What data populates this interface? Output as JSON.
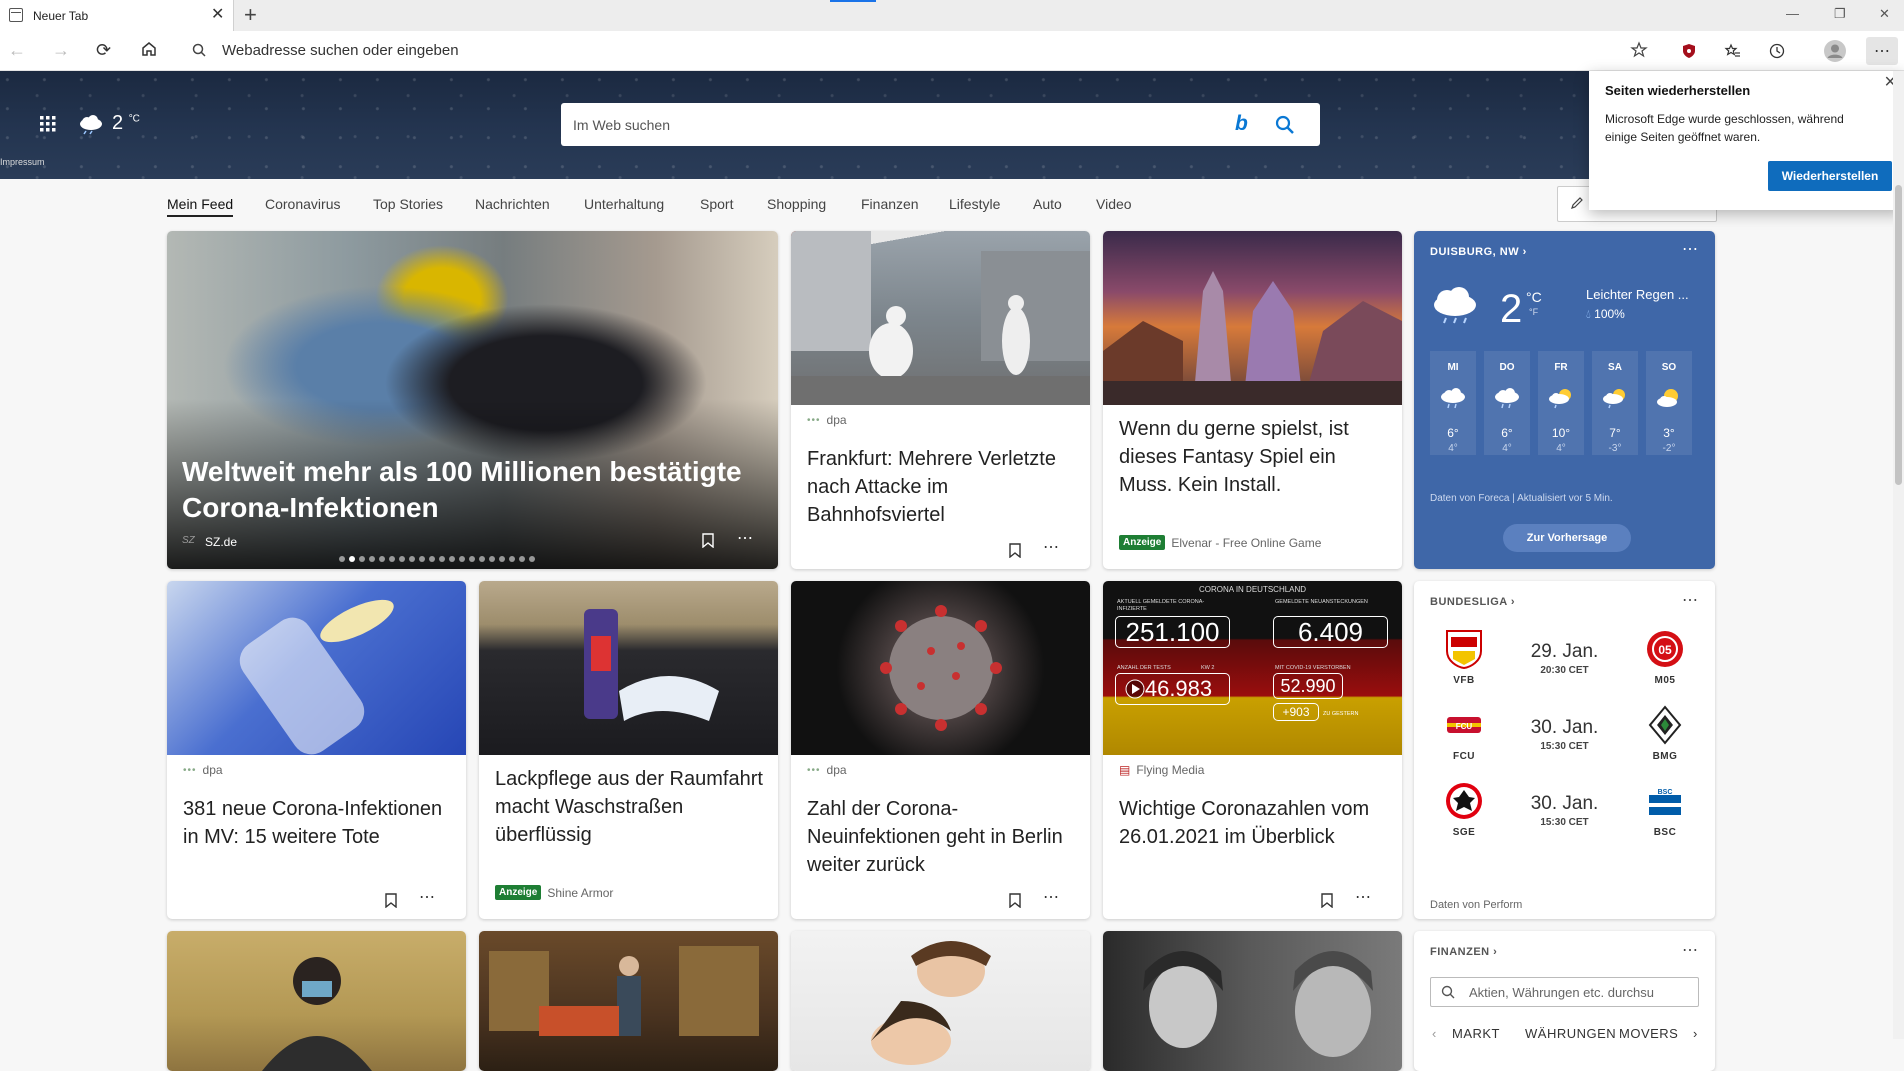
{
  "tab": {
    "title": "Neuer Tab"
  },
  "toolbar": {
    "address_placeholder": "Webadresse suchen oder eingeben"
  },
  "hero": {
    "temp": "2",
    "unit": "°C",
    "impressum": "Impressum",
    "search_placeholder": "Im Web suchen"
  },
  "feed_tabs": [
    "Mein Feed",
    "Coronavirus",
    "Top Stories",
    "Nachrichten",
    "Unterhaltung",
    "Sport",
    "Shopping",
    "Finanzen",
    "Lifestyle",
    "Auto",
    "Video"
  ],
  "restore_popup": {
    "title": "Seiten wiederherstellen",
    "body": "Microsoft Edge wurde geschlossen, während einige Seiten geöffnet waren.",
    "button": "Wiederherstellen"
  },
  "hero_card": {
    "title": "Weltweit mehr als 100 Millionen bestätigte Corona-Infektionen",
    "source": "SZ.de",
    "source_logo": "SZ",
    "slide_count": 20,
    "active_slide": 2
  },
  "cards": {
    "c1": {
      "source": "dpa",
      "title": "Frankfurt: Mehrere Verletzte nach Attacke im Bahnhofsviertel"
    },
    "c2": {
      "ad_label": "Anzeige",
      "source": "Elvenar - Free Online Game",
      "title": "Wenn du gerne spielst, ist dieses Fantasy Spiel ein Muss. Kein Install."
    },
    "c3": {
      "source": "dpa",
      "title": "381 neue Corona-Infektionen in MV: 15 weitere Tote"
    },
    "c4": {
      "ad_label": "Anzeige",
      "source": "Shine Armor",
      "title": "Lackpflege aus der Raumfahrt macht Waschstraßen überflüssig"
    },
    "c5": {
      "source": "dpa",
      "title": "Zahl der Corona-Neuinfektionen geht in Berlin weiter zurück"
    },
    "c6": {
      "source": "Flying Media",
      "title": "Wichtige Coronazahlen vom 26.01.2021 im Überblick",
      "graphic": {
        "header": "CORONA IN DEUTSCHLAND",
        "l1": "AKTUELL GEMELDETE CORONA-INFIZIERTE",
        "v1": "251.100",
        "l2": "GEMELDETE NEUANSTECKUNGEN",
        "v2": "6.409",
        "l3": "ANZAHL DER TESTS",
        "l3b": "KW 2",
        "v3": "46.983",
        "l4": "MIT COVID-19 VERSTORBEN",
        "v4": "52.990",
        "v5": "+903",
        "l5": "ZU GESTERN"
      }
    }
  },
  "weather": {
    "location": "DUISBURG, NW",
    "temp": "2",
    "unit_c": "°C",
    "unit_f": "°F",
    "condition": "Leichter Regen ...",
    "precip": "100%",
    "forecast": [
      {
        "day": "MI",
        "hi": "6°",
        "lo": "4°",
        "icon": "rain-cloud-icon"
      },
      {
        "day": "DO",
        "hi": "6°",
        "lo": "4°",
        "icon": "rain-cloud-icon"
      },
      {
        "day": "FR",
        "hi": "10°",
        "lo": "4°",
        "icon": "sun-rain-icon"
      },
      {
        "day": "SA",
        "hi": "7°",
        "lo": "-3°",
        "icon": "sun-rain-icon"
      },
      {
        "day": "SO",
        "hi": "3°",
        "lo": "-2°",
        "icon": "partly-cloudy-icon"
      }
    ],
    "attribution": "Daten von Foreca | Aktualisiert vor 5 Min.",
    "button": "Zur Vorhersage"
  },
  "bundesliga": {
    "header": "BUNDESLIGA",
    "matches": [
      {
        "home": "VFB",
        "away": "M05",
        "date": "29. Jan.",
        "time": "20:30 CET"
      },
      {
        "home": "FCU",
        "away": "BMG",
        "date": "30. Jan.",
        "time": "15:30 CET"
      },
      {
        "home": "SGE",
        "away": "BSC",
        "date": "30. Jan.",
        "time": "15:30 CET"
      }
    ],
    "attribution": "Daten von Perform"
  },
  "finance": {
    "header": "FINANZEN",
    "search_placeholder": "Aktien, Währungen etc. durchsu",
    "tabs": [
      "MARKT",
      "WÄHRUNGEN",
      "MOVERS"
    ]
  },
  "colors": {
    "accent": "#0f6cbd",
    "weather_bg": "#3f67a8",
    "ad_green": "#1e7e34"
  }
}
